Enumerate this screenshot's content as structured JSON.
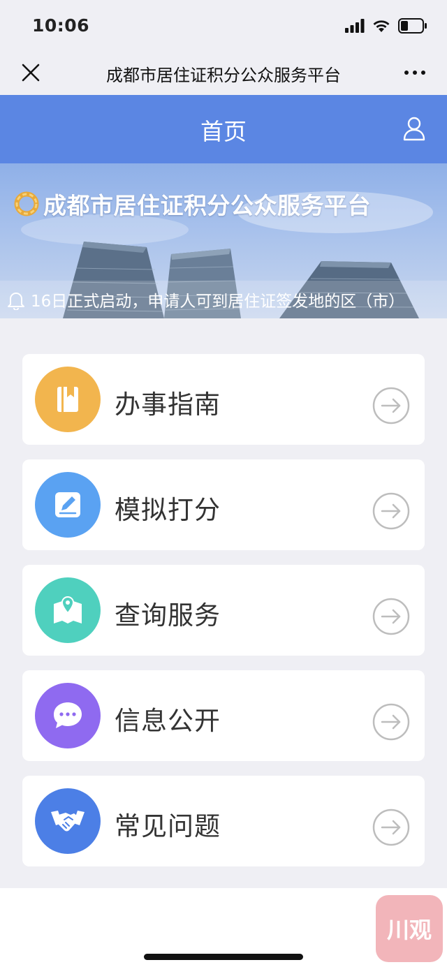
{
  "status_bar": {
    "time": "10:06"
  },
  "nav": {
    "title": "成都市居住证积分公众服务平台"
  },
  "header": {
    "title": "首页"
  },
  "banner": {
    "title": "成都市居住证积分公众服务平台",
    "notice": "16日正式启动，申请人可到居住证签发地的区（市）"
  },
  "menu": [
    {
      "label": "办事指南",
      "icon": "book-icon",
      "color": "#f2b54e"
    },
    {
      "label": "模拟打分",
      "icon": "edit-icon",
      "color": "#5aa2f2"
    },
    {
      "label": "查询服务",
      "icon": "map-pin-icon",
      "color": "#4fd0be"
    },
    {
      "label": "信息公开",
      "icon": "chat-bubble-icon",
      "color": "#8f6af0"
    },
    {
      "label": "常见问题",
      "icon": "handshake-icon",
      "color": "#4c7fe6"
    }
  ],
  "watermark": {
    "text": "川观"
  }
}
